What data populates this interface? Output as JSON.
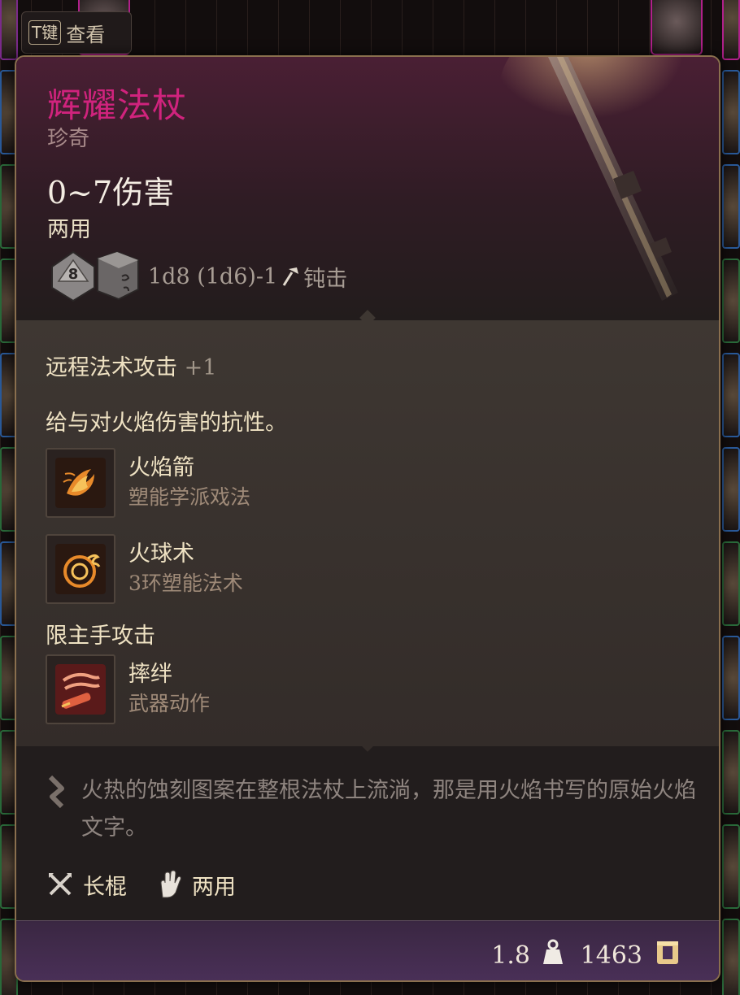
{
  "hint": {
    "key": "T键",
    "label": "查看"
  },
  "item": {
    "name": "辉耀法杖",
    "rarity": "珍奇",
    "damage": "0~7伤害",
    "handedness": "两用",
    "dice_formula": "1d8 (1d6)-1",
    "damage_type": "钝击",
    "dice_icons": [
      "d8-die-icon",
      "d6-die-icon"
    ],
    "d8_face": "8"
  },
  "properties": {
    "spell_attack_label": "远程法术攻击",
    "spell_attack_bonus": "+1",
    "resistance": "给与对火焰伤害的抗性。"
  },
  "abilities": [
    {
      "name": "火焰箭",
      "subtitle": "塑能学派戏法",
      "icon": "fire-bolt-icon"
    },
    {
      "name": "火球术",
      "subtitle": "3环塑能法术",
      "icon": "fireball-icon"
    }
  ],
  "restriction": "限主手攻击",
  "weapon_action": {
    "name": "摔绊",
    "subtitle": "武器动作",
    "icon": "topple-icon"
  },
  "description": "火热的蚀刻图案在整根法杖上流淌，那是用火焰书写的原始火焰文字。",
  "tags": [
    {
      "label": "长棍",
      "icon": "crossed-staves-icon"
    },
    {
      "label": "两用",
      "icon": "hand-icon"
    }
  ],
  "footer": {
    "weight": "1.8",
    "price": "1463"
  },
  "colors": {
    "rarity_name": "#d0237d",
    "frame_border": "#8a6f4e",
    "footer_purple": "#4a3058",
    "slot_green": "#2a6a3a"
  }
}
